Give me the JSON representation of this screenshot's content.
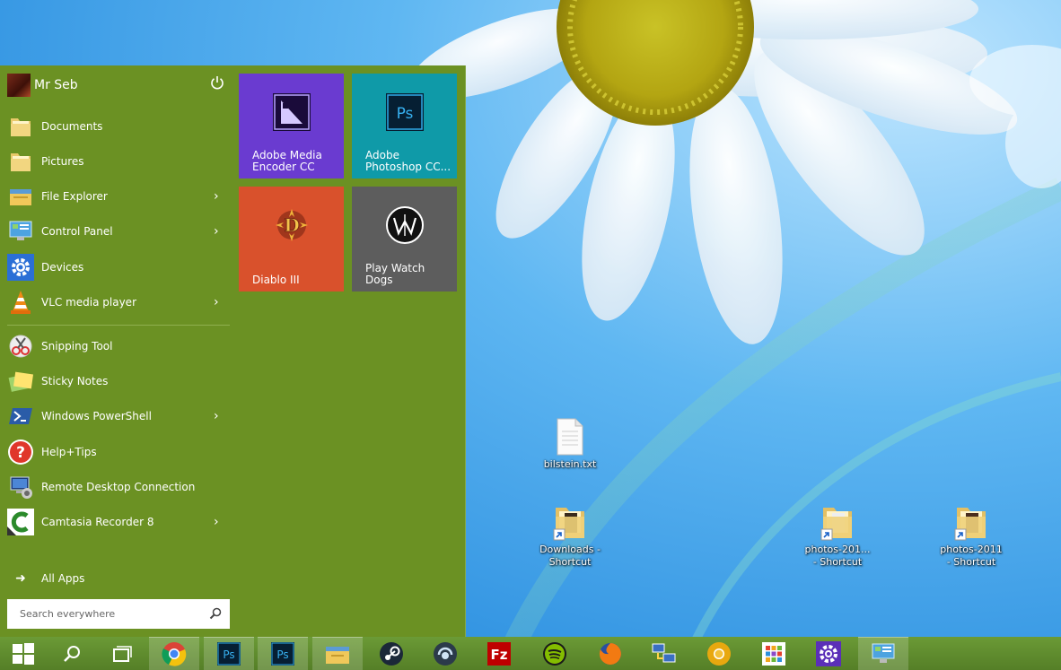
{
  "start_menu": {
    "user_name": "Mr Seb",
    "items": [
      {
        "label": "Documents",
        "icon": "folder-icon",
        "has_submenu": false
      },
      {
        "label": "Pictures",
        "icon": "folder-icon",
        "has_submenu": false
      },
      {
        "label": "File Explorer",
        "icon": "file-explorer-icon",
        "has_submenu": true
      },
      {
        "label": "Control Panel",
        "icon": "control-panel-icon",
        "has_submenu": true
      },
      {
        "label": "Devices",
        "icon": "gear-icon",
        "has_submenu": false
      },
      {
        "label": "VLC media player",
        "icon": "vlc-cone-icon",
        "has_submenu": true
      },
      {
        "label": "Snipping Tool",
        "icon": "scissors-icon",
        "has_submenu": false
      },
      {
        "label": "Sticky Notes",
        "icon": "sticky-notes-icon",
        "has_submenu": false
      },
      {
        "label": "Windows PowerShell",
        "icon": "powershell-icon",
        "has_submenu": true
      },
      {
        "label": "Help+Tips",
        "icon": "help-icon",
        "has_submenu": false
      },
      {
        "label": "Remote Desktop Connection",
        "icon": "remote-desktop-icon",
        "has_submenu": false
      },
      {
        "label": "Camtasia Recorder 8",
        "icon": "camtasia-icon",
        "has_submenu": true
      }
    ],
    "all_apps_label": "All Apps",
    "search_placeholder": "Search everywhere",
    "tiles": [
      {
        "label_line1": "Adobe Media",
        "label_line2": "Encoder CC",
        "color": "#6a3bd0",
        "icon": "media-encoder-icon"
      },
      {
        "label_line1": "Adobe",
        "label_line2": "Photoshop CC...",
        "color": "#0f9aa8",
        "icon": "photoshop-icon"
      },
      {
        "label_line1": "Diablo III",
        "label_line2": "",
        "color": "#d9512c",
        "icon": "diablo-icon"
      },
      {
        "label_line1": "Play Watch Dogs",
        "label_line2": "",
        "color": "#5d5d5d",
        "icon": "watch-dogs-icon"
      }
    ]
  },
  "desktop_icons": [
    {
      "line1": "bilstein.txt",
      "line2": "",
      "icon": "text-file-icon"
    },
    {
      "line1": "Downloads -",
      "line2": "Shortcut",
      "icon": "folder-shortcut-icon"
    },
    {
      "line1": "photos-201...",
      "line2": "- Shortcut",
      "icon": "folder-shortcut-icon"
    },
    {
      "line1": "photos-2011",
      "line2": "- Shortcut",
      "icon": "folder-shortcut-icon"
    }
  ],
  "taskbar": {
    "buttons": [
      {
        "icon": "windows-start-icon"
      },
      {
        "icon": "search-icon"
      },
      {
        "icon": "task-view-icon"
      },
      {
        "icon": "chrome-icon"
      },
      {
        "icon": "photoshop-icon"
      },
      {
        "icon": "photoshop-icon"
      },
      {
        "icon": "file-explorer-icon"
      },
      {
        "icon": "steam-icon"
      },
      {
        "icon": "teamspeak-icon"
      },
      {
        "icon": "filezilla-icon"
      },
      {
        "icon": "spotify-icon"
      },
      {
        "icon": "firefox-icon"
      },
      {
        "icon": "network-icon"
      },
      {
        "icon": "chrome-canary-icon"
      },
      {
        "icon": "apps-grid-icon"
      },
      {
        "icon": "gear-icon"
      },
      {
        "icon": "control-panel-icon"
      }
    ]
  },
  "colors": {
    "start_menu_bg": "#6b9123",
    "taskbar_bg": "#5d8a2c",
    "accent": "#6b9123"
  }
}
